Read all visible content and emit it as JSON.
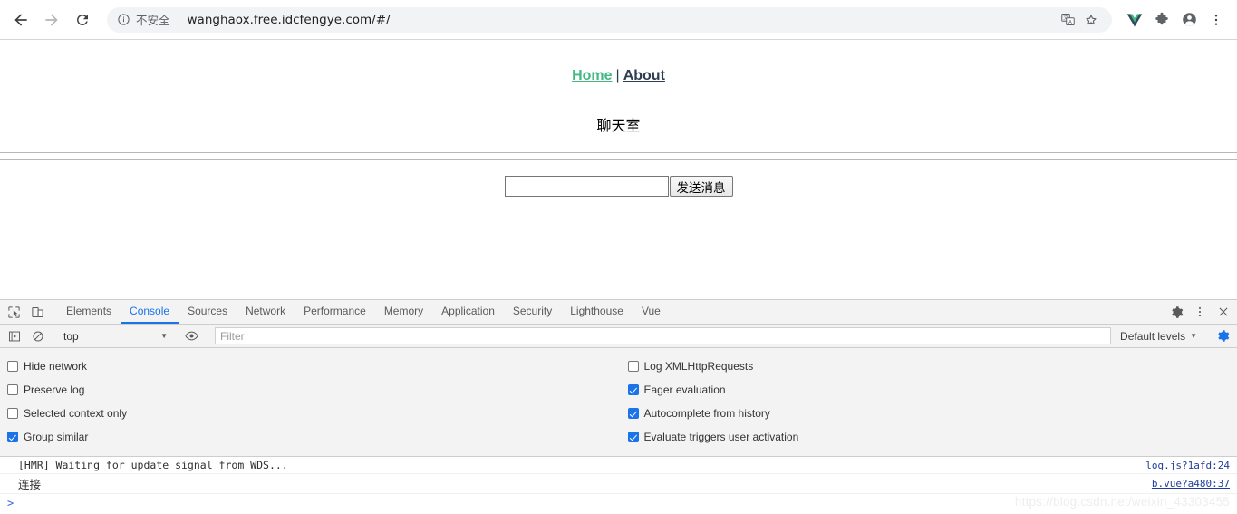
{
  "browser": {
    "back_label": "Back",
    "forward_label": "Forward",
    "reload_label": "Reload",
    "security_text": "不安全",
    "url": "wanghaox.free.idcfengye.com/#/",
    "translate_label": "Translate this page",
    "bookmark_label": "Bookmark this tab",
    "vue_devtools_label": "Vue.js devtools",
    "extensions_label": "Extensions",
    "profile_label": "Profile",
    "menu_label": "Customize and control Google Chrome"
  },
  "page": {
    "nav": {
      "home": "Home",
      "divider": "|",
      "about": "About",
      "home_color": "#42b983",
      "about_color": "#2c3e50"
    },
    "chat_title": "聊天室",
    "composer": {
      "input_value": "",
      "input_placeholder": "",
      "send_label": "发送消息"
    }
  },
  "devtools": {
    "inspect_label": "Inspect element",
    "device_toolbar_label": "Toggle device toolbar",
    "tabs": [
      {
        "label": "Elements",
        "active": false
      },
      {
        "label": "Console",
        "active": true
      },
      {
        "label": "Sources",
        "active": false
      },
      {
        "label": "Network",
        "active": false
      },
      {
        "label": "Performance",
        "active": false
      },
      {
        "label": "Memory",
        "active": false
      },
      {
        "label": "Application",
        "active": false
      },
      {
        "label": "Security",
        "active": false
      },
      {
        "label": "Lighthouse",
        "active": false
      },
      {
        "label": "Vue",
        "active": false
      }
    ],
    "settings_label": "Settings",
    "more_label": "More options",
    "close_label": "Close DevTools",
    "console_toolbar": {
      "sidebar_toggle_label": "Show console sidebar",
      "clear_label": "Clear console",
      "context": "top",
      "context_caret": "▼",
      "live_expression_label": "Create live expression",
      "filter_placeholder": "Filter",
      "filter_value": "",
      "levels": "Default levels",
      "levels_caret": "▼",
      "console_settings_label": "Console settings",
      "console_settings_color": "#1a73e8"
    },
    "settings_left": [
      {
        "label": "Hide network",
        "checked": false
      },
      {
        "label": "Preserve log",
        "checked": false
      },
      {
        "label": "Selected context only",
        "checked": false
      },
      {
        "label": "Group similar",
        "checked": true
      }
    ],
    "settings_right": [
      {
        "label": "Log XMLHttpRequests",
        "checked": false
      },
      {
        "label": "Eager evaluation",
        "checked": true
      },
      {
        "label": "Autocomplete from history",
        "checked": true
      },
      {
        "label": "Evaluate triggers user activation",
        "checked": true
      }
    ],
    "messages": [
      {
        "text": "[HMR] Waiting for update signal from WDS...",
        "source": "log.js?1afd:24",
        "cjk": false
      },
      {
        "text": "连接",
        "source": "b.vue?a480:37",
        "cjk": true
      }
    ],
    "prompt_caret": ">"
  },
  "watermark": "https://blog.csdn.net/weixin_43303455"
}
